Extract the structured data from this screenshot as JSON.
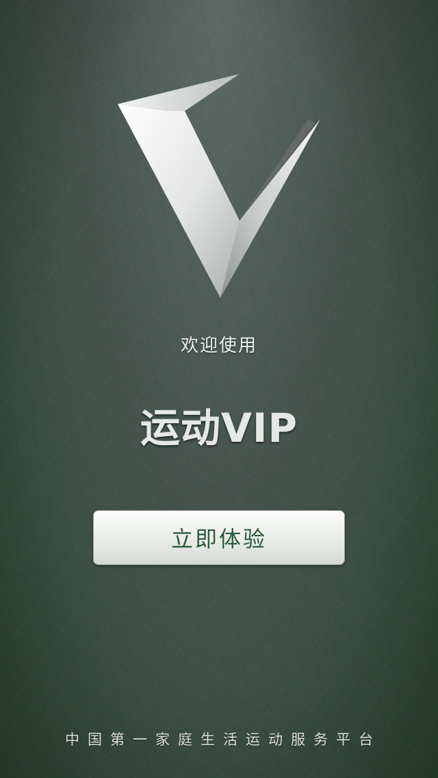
{
  "splash": {
    "welcome_text": "欢迎使用",
    "app_name": "运动VIP",
    "cta_label": "立即体验",
    "tagline": "中国第一家庭生活运动服务平台"
  },
  "logo": {
    "icon": "v-logo-icon"
  },
  "colors": {
    "background_top": "#5d6a66",
    "background_bottom": "#2f4a38",
    "button_text": "#2c5a3c",
    "text_light": "#eef1ef"
  }
}
